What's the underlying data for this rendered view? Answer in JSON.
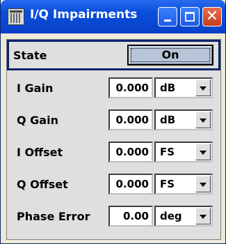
{
  "window": {
    "title": "I/Q Impairments",
    "icon": "dialog-grid-icon",
    "controls": [
      "minimize-icon",
      "maximize-icon",
      "close-icon"
    ],
    "close_glyph": "✕"
  },
  "state": {
    "label": "State",
    "button_label": "On"
  },
  "rows": [
    {
      "label": "I Gain",
      "value": "0.000",
      "unit": "dB"
    },
    {
      "label": "Q Gain",
      "value": "0.000",
      "unit": "dB"
    },
    {
      "label": "I Offset",
      "value": "0.000",
      "unit": "FS"
    },
    {
      "label": "Q Offset",
      "value": "0.000",
      "unit": "FS"
    },
    {
      "label": "Phase Error",
      "value": "0.00",
      "unit": "deg"
    }
  ],
  "colors": {
    "titlebar": "#0a4fdc",
    "close": "#c63b1a",
    "focus_border": "#0a246a",
    "on_button": "#b7c5d9"
  }
}
